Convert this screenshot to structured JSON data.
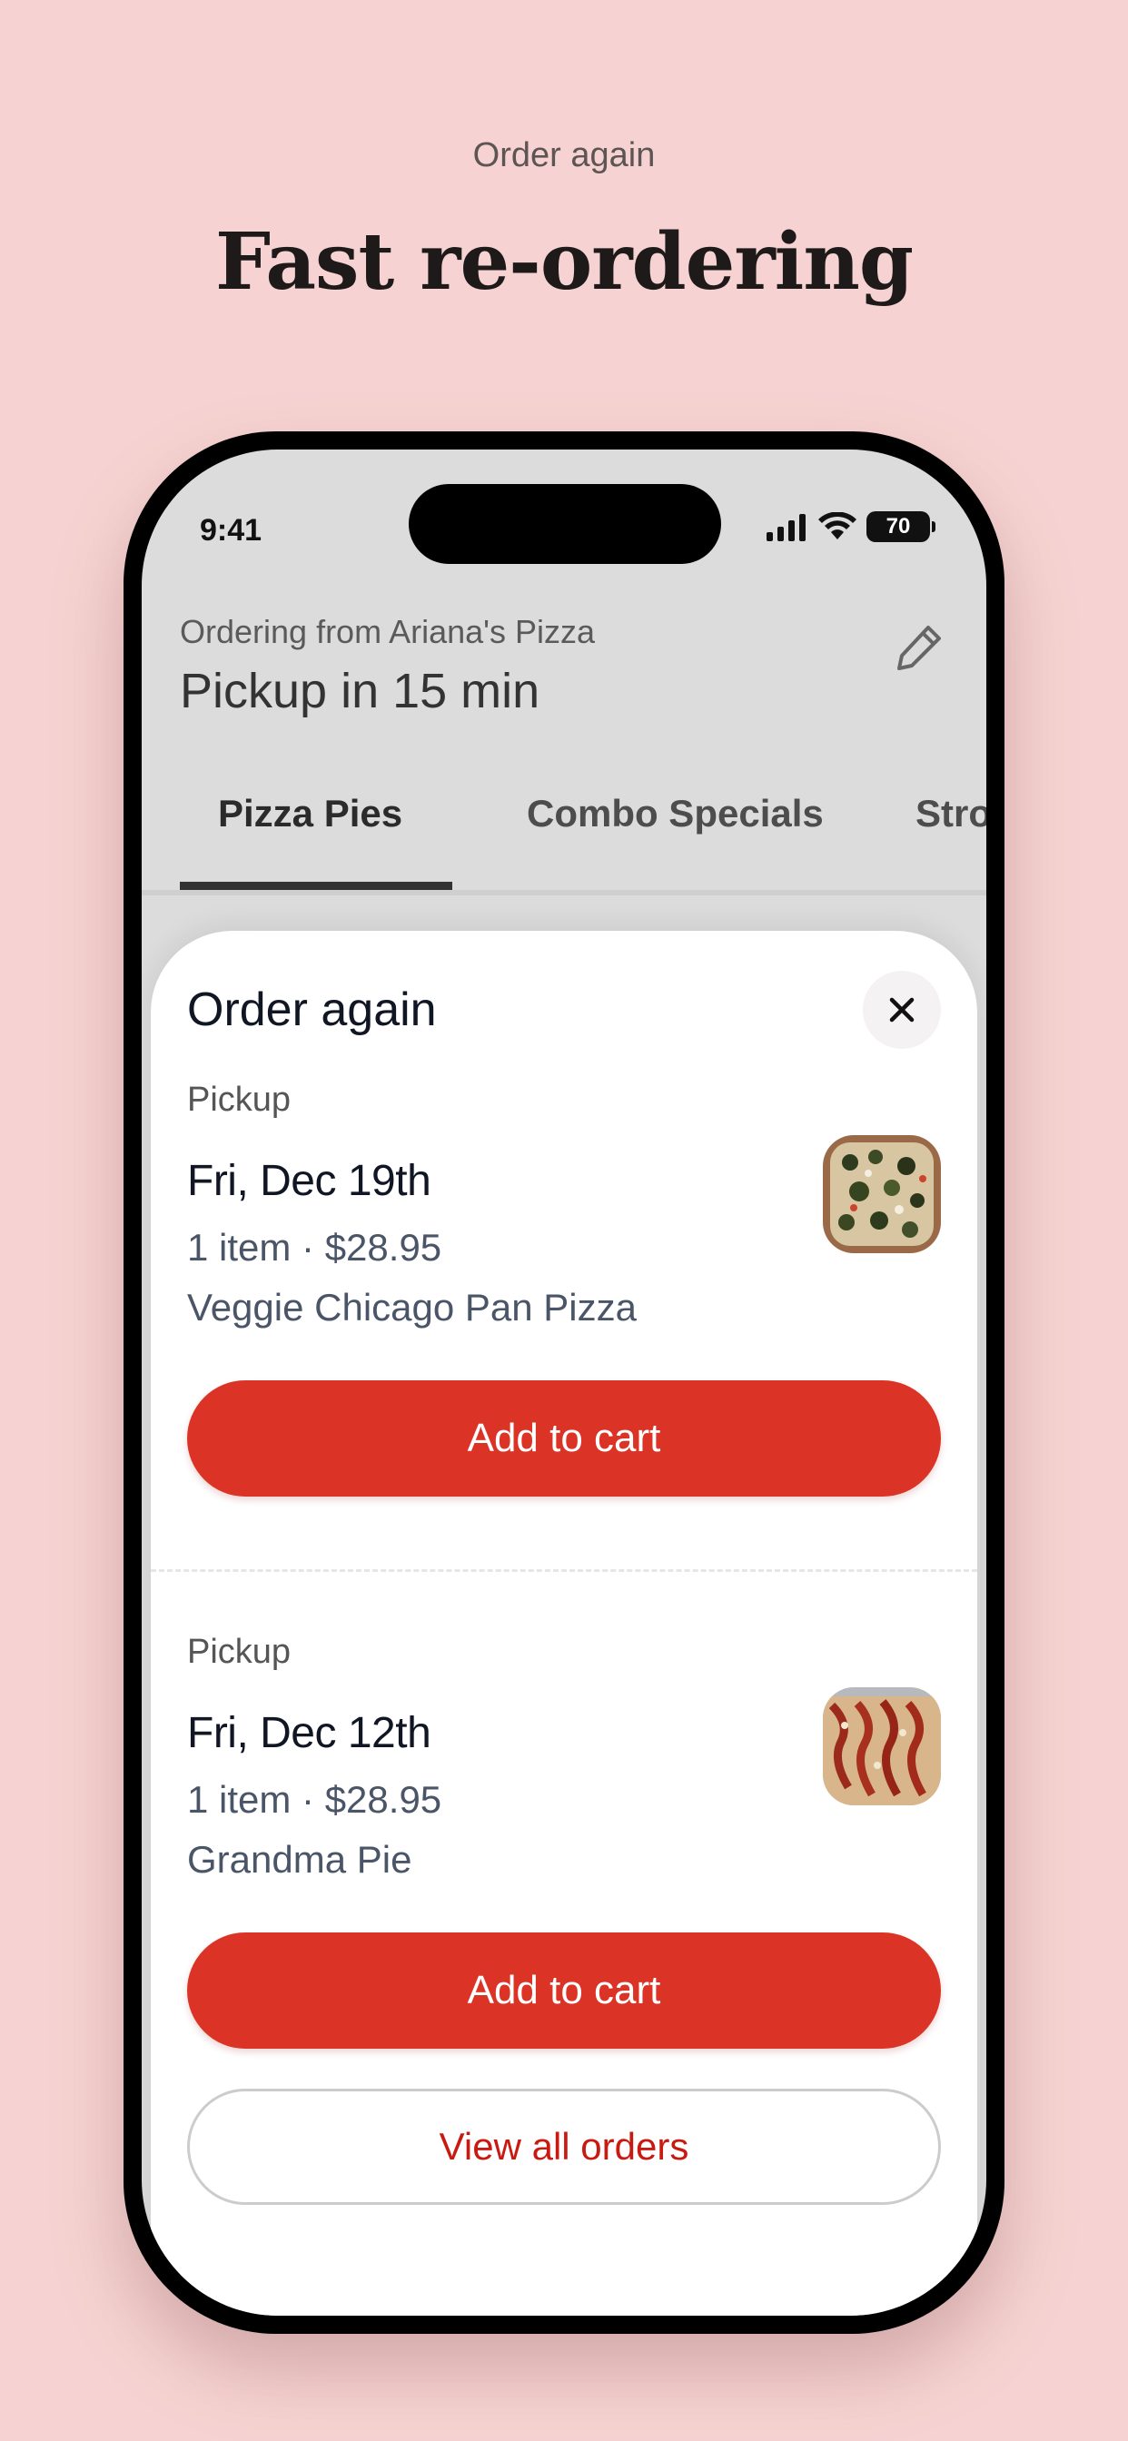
{
  "promo": {
    "eyebrow": "Order again",
    "headline": "Fast re-ordering"
  },
  "status_bar": {
    "time": "9:41",
    "battery": "70",
    "icons": [
      "signal-icon",
      "wifi-icon",
      "battery-icon"
    ]
  },
  "header": {
    "ordering_from": "Ordering from Ariana's Pizza",
    "pickup_title": "Pickup in 15 min",
    "edit_icon": "pencil-icon"
  },
  "tabs": [
    {
      "label": "Pizza Pies",
      "active": true
    },
    {
      "label": "Combo Specials",
      "active": false
    },
    {
      "label": "Strom",
      "active": false
    }
  ],
  "sheet": {
    "title": "Order again",
    "close_icon": "close-icon",
    "orders": [
      {
        "type": "Pickup",
        "date": "Fri, Dec 19th",
        "meta": "1 item · $28.95",
        "name": "Veggie Chicago Pan Pizza",
        "button": "Add to cart"
      },
      {
        "type": "Pickup",
        "date": "Fri, Dec 12th",
        "meta": "1 item · $28.95",
        "name": "Grandma Pie",
        "button": "Add to cart"
      }
    ],
    "view_all": "View all orders"
  },
  "colors": {
    "background": "#f6d3d2",
    "accent": "#db3426",
    "link": "#c91a12"
  }
}
